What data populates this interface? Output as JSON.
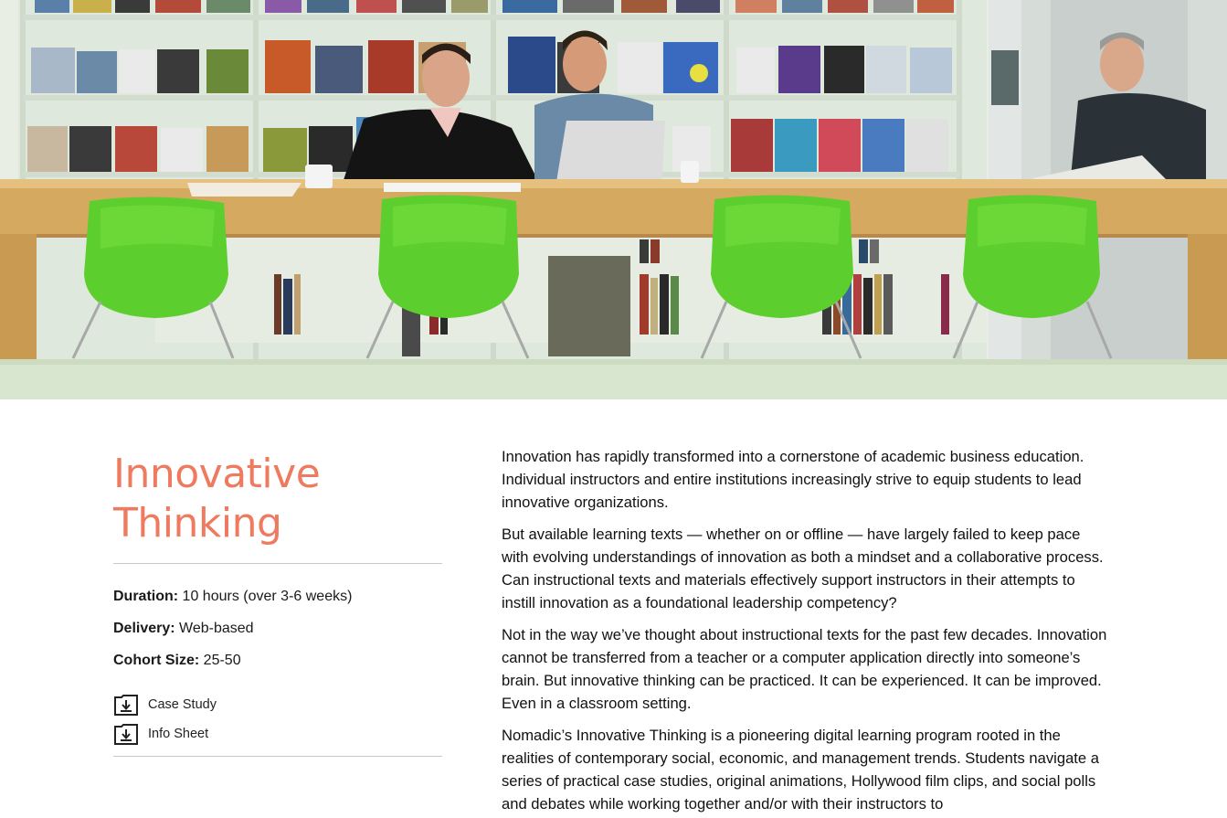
{
  "hero": {
    "image": "photo of three people working at a long wooden library table with bright green chairs in front of magazine shelves"
  },
  "program": {
    "title_line1": "Innovative",
    "title_line2": "Thinking",
    "details": [
      {
        "key": "Duration:",
        "value": " 10 hours (over 3-6 weeks)"
      },
      {
        "key": "Delivery:",
        "value": " Web-based"
      },
      {
        "key": "Cohort Size:",
        "value": " 25-50"
      }
    ],
    "downloads": [
      {
        "label": "Case Study",
        "icon": "download-tray-icon"
      },
      {
        "label": "Info Sheet",
        "icon": "download-tray-icon"
      }
    ]
  },
  "body": {
    "paragraphs": [
      "Innovation has rapidly transformed into a cornerstone of academic business education. Individual instructors and entire institutions increasingly strive to equip students to lead innovative organizations.",
      "But available learning texts — whether on or offline — have largely failed to keep pace with evolving understandings of innovation as both a mindset and a collaborative process. Can instructional texts and materials effectively support instructors in their attempts to instill innovation as a foundational leadership competency?",
      "Not in the way we’ve thought about instructional texts for the past few decades. Innovation cannot be transferred from a teacher or a computer application directly into someone’s brain. But innovative thinking can be practiced. It can be experienced. It can be improved. Even in a classroom setting.",
      "Nomadic’s Innovative Thinking is a pioneering digital learning program rooted in the realities of contemporary social, economic, and management trends. Students navigate a series of practical case studies, original animations, Hollywood film clips, and social polls and debates while working together and/or with their instructors to"
    ]
  },
  "colors": {
    "title": "#ee7a5f",
    "chair_green": "#5ccf2e",
    "table_wood": "#d8ad63",
    "rule": "#c9c9c9"
  }
}
